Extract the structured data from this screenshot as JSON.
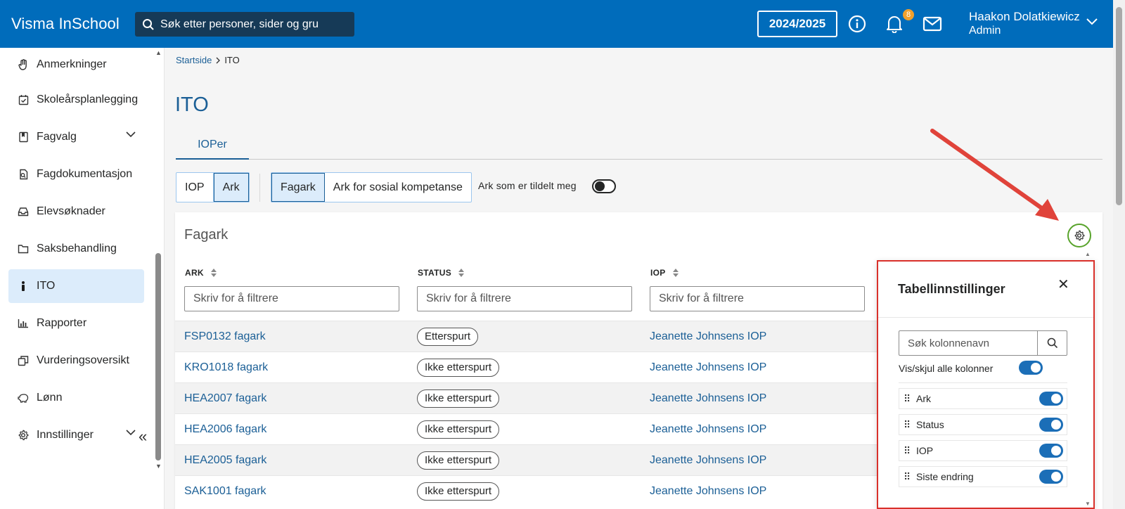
{
  "topbar": {
    "brand": "Visma InSchool",
    "search_placeholder": "Søk etter personer, sider og gru",
    "school_year": "2024/2025",
    "notification_count": "8",
    "user_name": "Haakon Dolatkiewicz",
    "user_role": "Admin",
    "colors": {
      "bar": "#006cbb",
      "search_bg": "#163a57",
      "badge": "#f1a02b"
    }
  },
  "sidebar": {
    "items": [
      {
        "label": "Anmerkninger",
        "icon": "hand-icon"
      },
      {
        "label": "Skoleårsplanlegging",
        "icon": "calendar-check-icon"
      },
      {
        "label": "Fagvalg",
        "icon": "bookmark-book-icon",
        "expandable": true
      },
      {
        "label": "Fagdokumentasjon",
        "icon": "document-search-icon"
      },
      {
        "label": "Elevsøknader",
        "icon": "inbox-icon"
      },
      {
        "label": "Saksbehandling",
        "icon": "folder-icon"
      },
      {
        "label": "ITO",
        "icon": "person-icon",
        "active": true
      },
      {
        "label": "Rapporter",
        "icon": "bar-chart-icon"
      },
      {
        "label": "Vurderingsoversikt",
        "icon": "clipboard-icon"
      },
      {
        "label": "Lønn",
        "icon": "piggy-bank-icon"
      },
      {
        "label": "Innstillinger",
        "icon": "gear-icon",
        "expandable": true
      }
    ]
  },
  "breadcrumb": {
    "home": "Startside",
    "current": "ITO"
  },
  "page": {
    "title": "ITO",
    "tab": "IOPer"
  },
  "filters": {
    "group1": [
      "IOP",
      "Ark"
    ],
    "group1_selected": "Ark",
    "group2": [
      "Fagark",
      "Ark for sosial kompetanse"
    ],
    "group2_selected": "Fagark",
    "assigned_toggle_label": "Ark som er tildelt meg",
    "assigned_toggle_on": false
  },
  "table": {
    "title": "Fagark",
    "columns": [
      "ARK",
      "STATUS",
      "IOP"
    ],
    "filter_placeholder": "Skriv for å filtrere",
    "rows": [
      {
        "ark": "FSP0132 fagark",
        "status": "Etterspurt",
        "iop": "Jeanette Johnsens IOP"
      },
      {
        "ark": "KRO1018 fagark",
        "status": "Ikke etterspurt",
        "iop": "Jeanette Johnsens IOP"
      },
      {
        "ark": "HEA2007 fagark",
        "status": "Ikke etterspurt",
        "iop": "Jeanette Johnsens IOP"
      },
      {
        "ark": "HEA2006 fagark",
        "status": "Ikke etterspurt",
        "iop": "Jeanette Johnsens IOP"
      },
      {
        "ark": "HEA2005 fagark",
        "status": "Ikke etterspurt",
        "iop": "Jeanette Johnsens IOP"
      },
      {
        "ark": "SAK1001 fagark",
        "status": "Ikke etterspurt",
        "iop": "Jeanette Johnsens IOP"
      }
    ]
  },
  "settings_panel": {
    "title": "Tabellinnstillinger",
    "search_placeholder": "Søk kolonnenavn",
    "show_all_label": "Vis/skjul alle kolonner",
    "show_all_on": true,
    "columns": [
      {
        "label": "Ark",
        "visible": true
      },
      {
        "label": "Status",
        "visible": true
      },
      {
        "label": "IOP",
        "visible": true
      },
      {
        "label": "Siste endring",
        "visible": true
      }
    ]
  },
  "annotation": {
    "arrow_color": "#e0433a",
    "panel_highlight_color": "#d9302a",
    "gear_highlight_color": "#58a32b"
  }
}
